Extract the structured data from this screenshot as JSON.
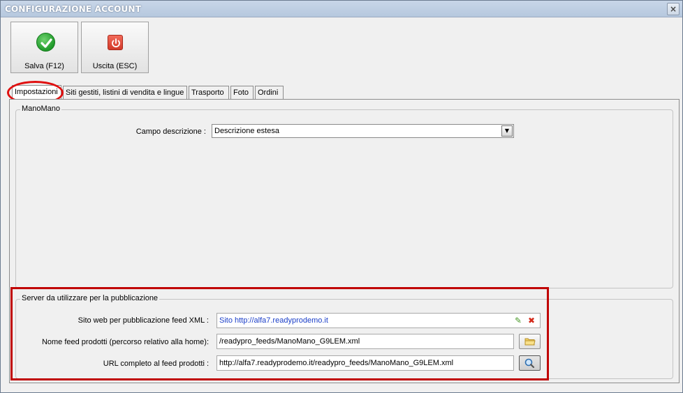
{
  "window": {
    "title": "CONFIGURAZIONE ACCOUNT",
    "close_glyph": "×"
  },
  "toolbar": {
    "save_label": "Salva (F12)",
    "save_icon": "check-icon",
    "exit_label": "Uscita (ESC)",
    "exit_icon": "power-icon"
  },
  "tabs": [
    {
      "label": "Impostazioni",
      "active": true
    },
    {
      "label": "Siti gestiti, listini di vendita e lingue",
      "active": false
    },
    {
      "label": "Trasporto",
      "active": false
    },
    {
      "label": "Foto",
      "active": false
    },
    {
      "label": "Ordini",
      "active": false
    }
  ],
  "manomano_group": {
    "legend": "ManoMano",
    "campo_descrizione_label": "Campo descrizione :",
    "campo_descrizione_value": "Descrizione estesa"
  },
  "server_group": {
    "legend": "Server da utilizzare per la pubblicazione",
    "sito_label": "Sito web per pubblicazione feed XML :",
    "sito_value": "Sito http://alfa7.readyprodemo.it",
    "nome_feed_label": "Nome feed prodotti (percorso relativo alla home):",
    "nome_feed_value": "/readypro_feeds/ManoMano_G9LEM.xml",
    "url_label": "URL completo al feed prodotti :",
    "url_value": "http://alfa7.readyprodemo.it/readypro_feeds/ManoMano_G9LEM.xml"
  },
  "colors": {
    "highlight": "#e01010",
    "link": "#1a3ec8",
    "title_bar": "#c8d6e8"
  }
}
